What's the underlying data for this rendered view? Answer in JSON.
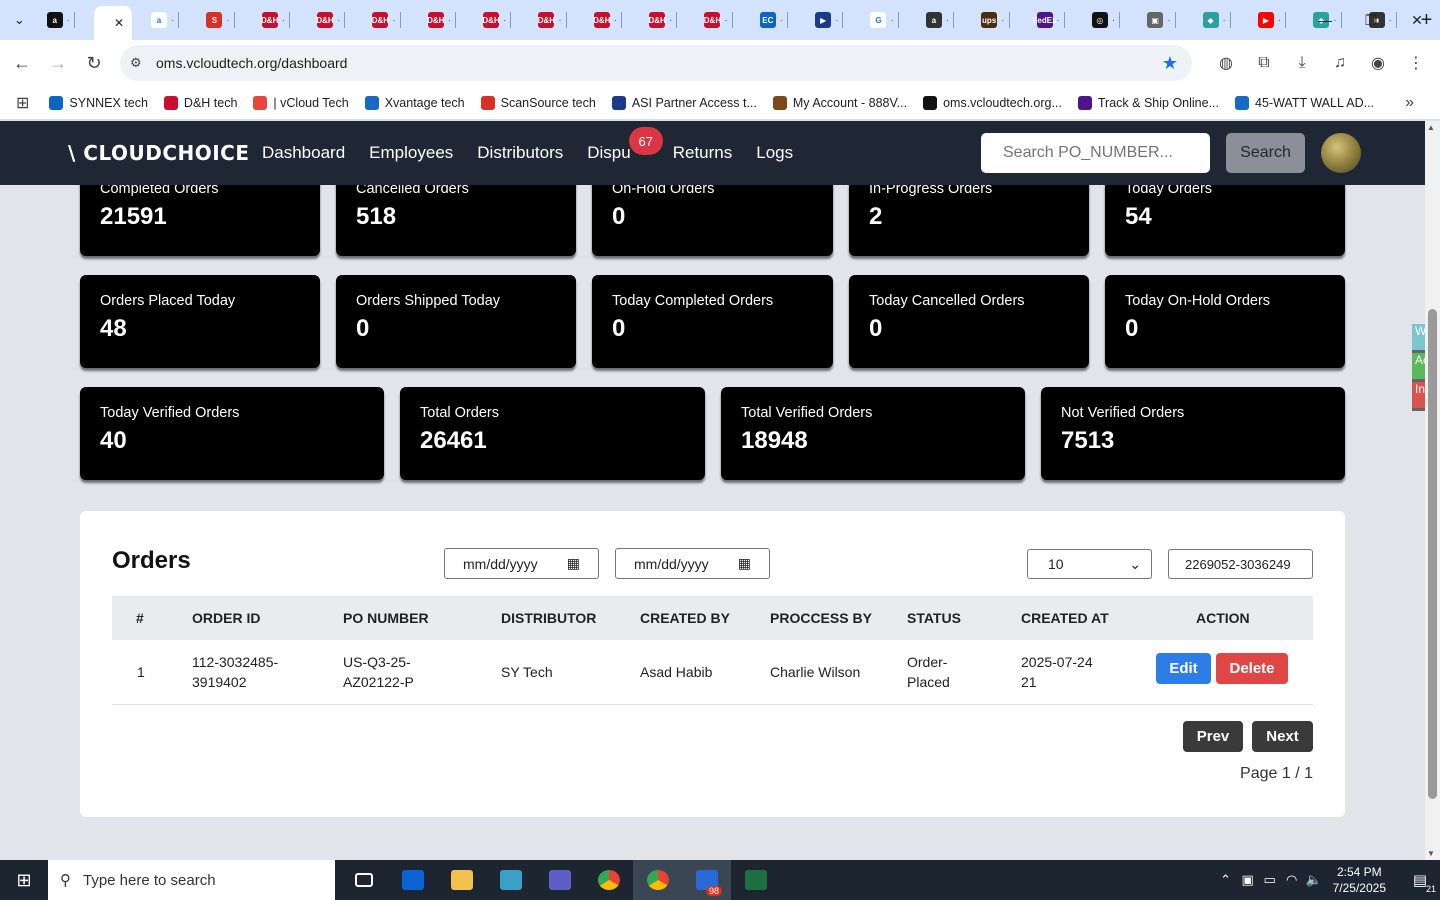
{
  "browser": {
    "tabs": [
      {
        "icon": "amazon-icon",
        "color": "#111111",
        "glyph": "a",
        "active": false
      },
      {
        "icon": "blank-icon",
        "color": "#ffffff",
        "glyph": "",
        "active": true
      },
      {
        "icon": "amazon-icon",
        "color": "#ffffff",
        "glyph": "a",
        "active": false
      },
      {
        "icon": "scansource-icon",
        "color": "#d93025",
        "glyph": "S",
        "active": false
      },
      {
        "icon": "dh-icon",
        "color": "#c8102e",
        "glyph": "D&H",
        "active": false
      },
      {
        "icon": "dh-icon",
        "color": "#c8102e",
        "glyph": "D&H",
        "active": false
      },
      {
        "icon": "dh-icon",
        "color": "#c8102e",
        "glyph": "D&H",
        "active": false
      },
      {
        "icon": "dh-icon",
        "color": "#c8102e",
        "glyph": "D&H",
        "active": false
      },
      {
        "icon": "dh-icon",
        "color": "#c8102e",
        "glyph": "D&H",
        "active": false
      },
      {
        "icon": "dh-icon",
        "color": "#c8102e",
        "glyph": "D&H",
        "active": false
      },
      {
        "icon": "dh-icon",
        "color": "#c8102e",
        "glyph": "D&H",
        "active": false
      },
      {
        "icon": "dh-icon",
        "color": "#c8102e",
        "glyph": "D&H",
        "active": false
      },
      {
        "icon": "dh-icon",
        "color": "#c8102e",
        "glyph": "D&H",
        "active": false
      },
      {
        "icon": "synnex-icon",
        "color": "#0a66c2",
        "glyph": "EC",
        "active": false
      },
      {
        "icon": "asi-icon",
        "color": "#1a3a8a",
        "glyph": "▶",
        "active": false
      },
      {
        "icon": "google-icon",
        "color": "#ffffff",
        "glyph": "G",
        "active": false
      },
      {
        "icon": "amazon-icon",
        "color": "#333333",
        "glyph": "a",
        "active": false
      },
      {
        "icon": "ups-icon",
        "color": "#4b2c0f",
        "glyph": "ups",
        "active": false
      },
      {
        "icon": "fedex-icon",
        "color": "#4d148c",
        "glyph": "FedEx",
        "active": false
      },
      {
        "icon": "openai-icon",
        "color": "#111111",
        "glyph": "◎",
        "active": false
      },
      {
        "icon": "truck-icon",
        "color": "#666666",
        "glyph": "▣",
        "active": false
      },
      {
        "icon": "diamond-icon",
        "color": "#2aa0a0",
        "glyph": "◆",
        "active": false
      },
      {
        "icon": "youtube-icon",
        "color": "#ff0000",
        "glyph": "▶",
        "active": false
      },
      {
        "icon": "diamond-icon",
        "color": "#2aa0a0",
        "glyph": "◆",
        "active": false
      },
      {
        "icon": "extension-icon",
        "color": "#333333",
        "glyph": "■",
        "active": false
      }
    ],
    "url": "oms.vcloudtech.org/dashboard",
    "bookmarks": [
      {
        "label": "SYNNEX tech",
        "icon": "synnex-icon",
        "color": "#0a66c2"
      },
      {
        "label": "D&H tech",
        "icon": "dh-icon",
        "color": "#c8102e"
      },
      {
        "label": "| vCloud Tech",
        "icon": "vcloud-icon",
        "color": "#e8453c"
      },
      {
        "label": "Xvantage tech",
        "icon": "xvantage-icon",
        "color": "#1769c4"
      },
      {
        "label": "ScanSource tech",
        "icon": "scansource-icon",
        "color": "#d93025"
      },
      {
        "label": "ASI Partner Access t...",
        "icon": "asi-icon",
        "color": "#1a3a8a"
      },
      {
        "label": "My Account - 888V...",
        "icon": "account-icon",
        "color": "#7a4a1a"
      },
      {
        "label": "oms.vcloudtech.org...",
        "icon": "vcloud-icon",
        "color": "#111111"
      },
      {
        "label": "Track & Ship Online...",
        "icon": "fedex-icon",
        "color": "#4d148c"
      },
      {
        "label": "45-WATT WALL AD...",
        "icon": "xvantage-icon",
        "color": "#1769c4"
      }
    ]
  },
  "app": {
    "logo": "\\ CLOUDCHOICE",
    "nav": {
      "dashboard": "Dashboard",
      "employees": "Employees",
      "distributors": "Distributors",
      "disputes": "Dispu",
      "disputes_badge": "67",
      "returns": "Returns",
      "logs": "Logs"
    },
    "search_placeholder": "Search PO_NUMBER...",
    "search_button": "Search"
  },
  "stats": {
    "row1": [
      {
        "label": "Completed Orders",
        "value": "21591"
      },
      {
        "label": "Cancelled Orders",
        "value": "518"
      },
      {
        "label": "On-Hold Orders",
        "value": "0"
      },
      {
        "label": "In-Progress Orders",
        "value": "2"
      },
      {
        "label": "Today Orders",
        "value": "54"
      }
    ],
    "row2": [
      {
        "label": "Orders Placed Today",
        "value": "48"
      },
      {
        "label": "Orders Shipped Today",
        "value": "0"
      },
      {
        "label": "Today Completed Orders",
        "value": "0"
      },
      {
        "label": "Today Cancelled Orders",
        "value": "0"
      },
      {
        "label": "Today On-Hold Orders",
        "value": "0"
      }
    ],
    "row3": [
      {
        "label": "Today Verified Orders",
        "value": "40"
      },
      {
        "label": "Total Orders",
        "value": "26461"
      },
      {
        "label": "Total Verified Orders",
        "value": "18948"
      },
      {
        "label": "Not Verified Orders",
        "value": "7513"
      }
    ]
  },
  "orders": {
    "title": "Orders",
    "date_placeholder_from": "mm/dd/yyyy",
    "date_placeholder_to": "mm/dd/yyyy",
    "page_size": "10",
    "filter_value": "2269052-3036249",
    "columns": [
      "#",
      "ORDER ID",
      "PO NUMBER",
      "DISTRIBUTOR",
      "CREATED BY",
      "PROCCESS BY",
      "STATUS",
      "CREATED AT",
      "ACTION"
    ],
    "rows": [
      {
        "num": "1",
        "order_id_1": "112-3032485-",
        "order_id_2": "3919402",
        "po_1": "US-Q3-25-",
        "po_2": "AZ02122-P",
        "distributor": "SY Tech",
        "created_by": "Asad Habib",
        "processed_by": "Charlie Wilson",
        "status_1": "Order-",
        "status_2": "Placed",
        "created_at_1": "2025-07-24",
        "created_at_2": "21"
      }
    ],
    "edit_label": "Edit",
    "delete_label": "Delete",
    "prev_label": "Prev",
    "next_label": "Next",
    "page_info": "Page 1 / 1"
  },
  "side_widget": [
    "W",
    "Ac",
    "In"
  ],
  "taskbar": {
    "search_placeholder": "Type here to search",
    "apps": [
      {
        "icon": "task-view-icon",
        "color": "#ffffff"
      },
      {
        "icon": "outlook-icon",
        "color": "#0a64d6"
      },
      {
        "icon": "file-explorer-icon",
        "color": "#f2c14e"
      },
      {
        "icon": "app-diamond-icon",
        "color": "#3aa0c8"
      },
      {
        "icon": "teams-icon",
        "color": "#5b5fc7"
      },
      {
        "icon": "chrome-icon",
        "color": "#34a853"
      },
      {
        "icon": "chrome-icon",
        "color": "#34a853"
      },
      {
        "icon": "zoho-icon",
        "color": "#2a6ad8"
      },
      {
        "icon": "excel-icon",
        "color": "#1d6f42"
      }
    ],
    "zoho_badge": "98",
    "time": "2:54 PM",
    "date": "7/25/2025",
    "notif_count": "21"
  }
}
